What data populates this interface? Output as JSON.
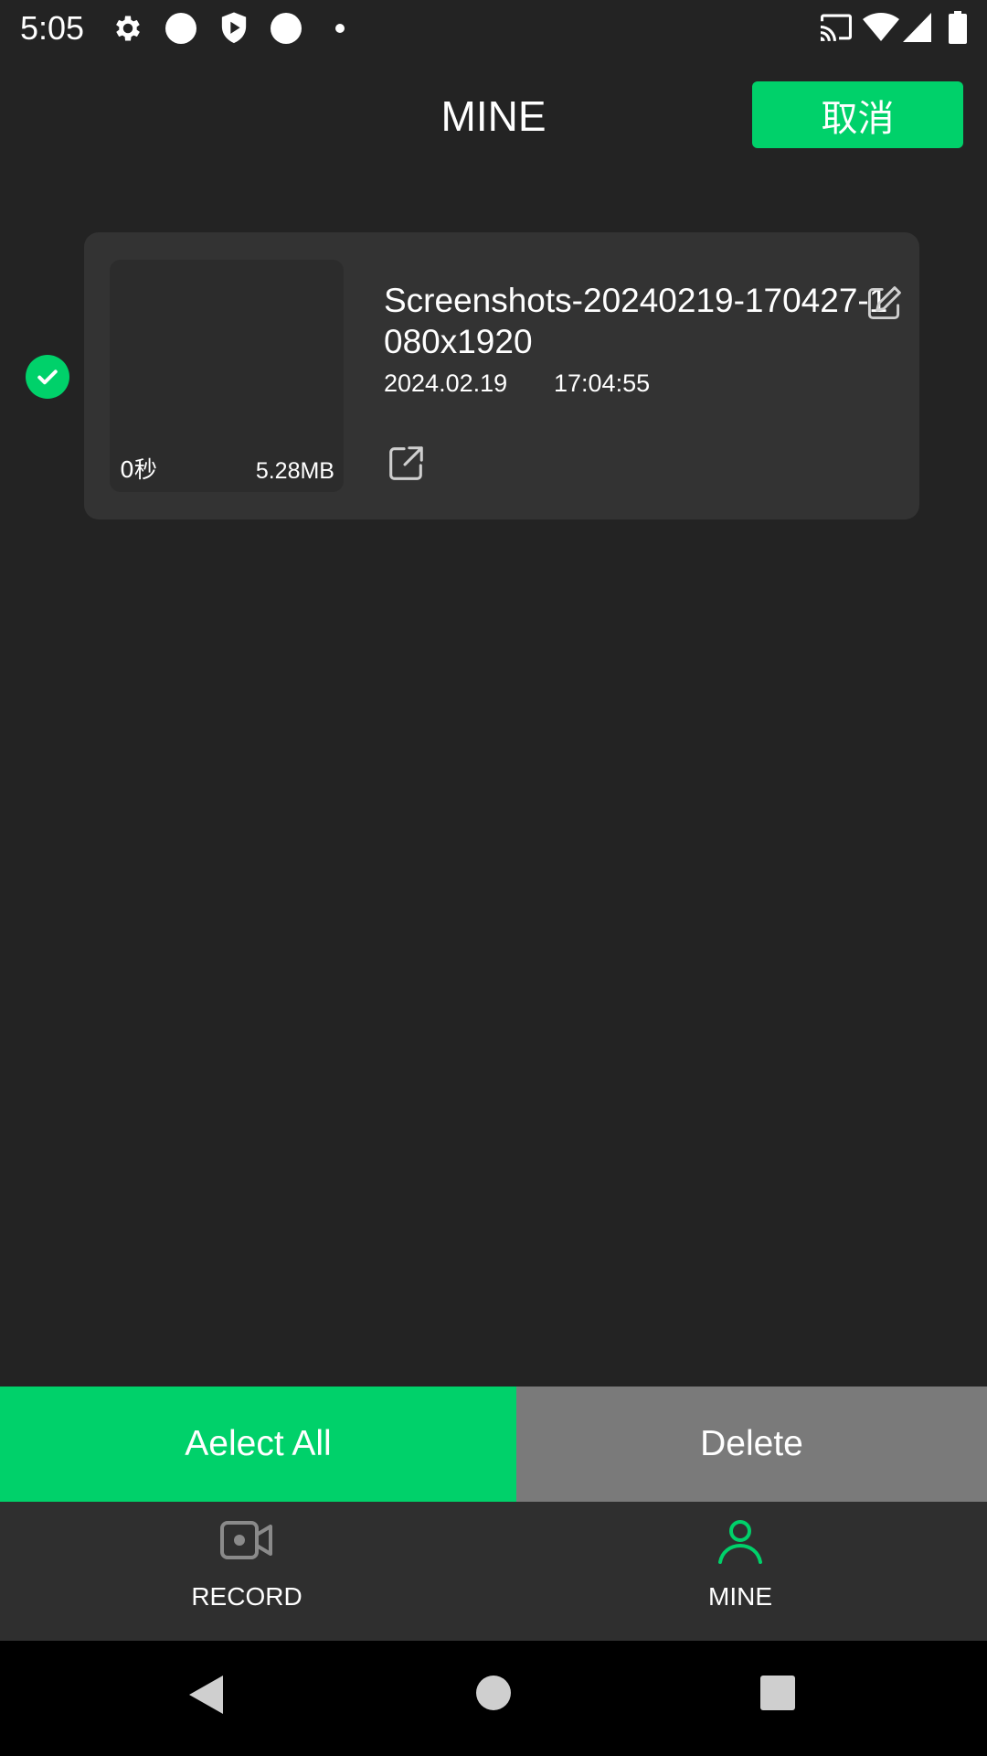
{
  "status_bar": {
    "time": "5:05",
    "left_icons": [
      "gear-icon",
      "circle-icon",
      "shield-play-icon",
      "circle-icon",
      "dot-icon"
    ],
    "right_icons": [
      "cast-icon",
      "wifi-icon",
      "signal-icon",
      "battery-icon"
    ]
  },
  "header": {
    "title": "MINE",
    "cancel_label": "取消"
  },
  "recordings": [
    {
      "selected": true,
      "duration": "0秒",
      "size": "5.28MB",
      "name": "Screenshots-20240219-170427-1080x1920",
      "date": "2024.02.19",
      "time": "17:04:55"
    }
  ],
  "actions": {
    "select_all_label": "Aelect All",
    "delete_label": "Delete"
  },
  "bottom_nav": {
    "items": [
      {
        "label": "RECORD",
        "icon": "video-camera-icon",
        "active": false
      },
      {
        "label": "MINE",
        "icon": "person-icon",
        "active": true
      }
    ]
  },
  "colors": {
    "accent": "#00d16a",
    "background": "#232323",
    "card": "#333333",
    "delete_bg": "#7a7a7a",
    "nav_inactive": "#8a8a8a"
  }
}
